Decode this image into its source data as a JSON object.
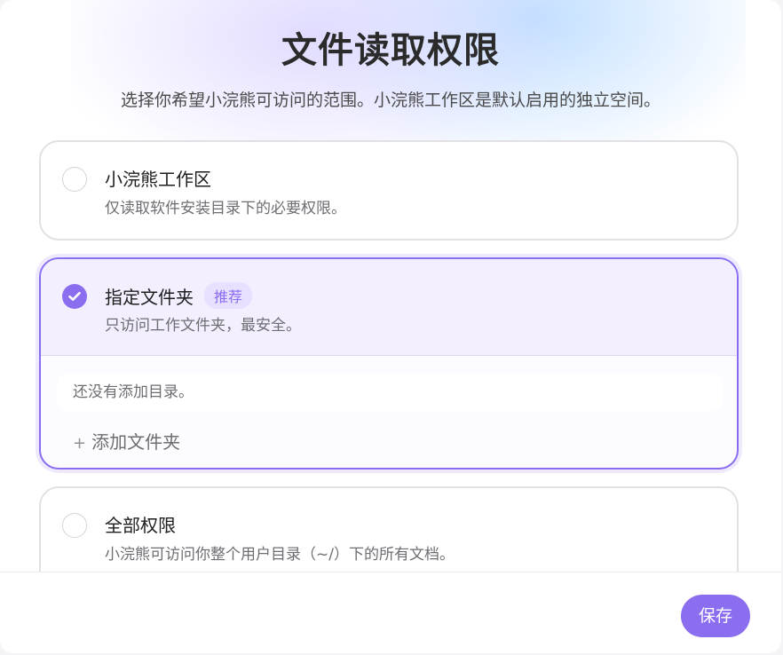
{
  "dialog": {
    "title": "文件读取权限",
    "subtitle": "选择你希望小浣熊可访问的范围。小浣熊工作区是默认启用的独立空间。"
  },
  "options": [
    {
      "title": "小浣熊工作区",
      "description": "仅读取软件安装目录下的必要权限。",
      "selected": false
    },
    {
      "title": "指定文件夹",
      "badge": "推荐",
      "description": "只访问工作文件夹，最安全。",
      "selected": true,
      "empty_text": "还没有添加目录。",
      "add_label": "添加文件夹",
      "add_icon": "plus-icon"
    },
    {
      "title": "全部权限",
      "description": "小浣熊可访问你整个用户目录（~/）下的所有文档。",
      "selected": false
    }
  ],
  "footer": {
    "save_label": "保存"
  },
  "colors": {
    "accent": "#8b6df0",
    "accent_light": "#f3efff",
    "badge_bg": "#e7e0ff"
  }
}
